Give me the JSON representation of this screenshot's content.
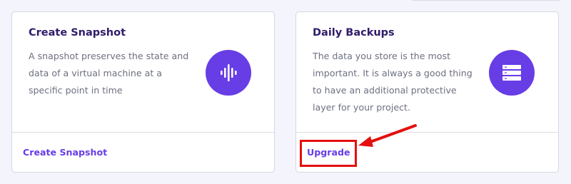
{
  "cards": [
    {
      "title": "Create Snapshot",
      "description": "A snapshot preserves the state and data of a virtual machine at a specific point in time",
      "icon": "soundwave-icon",
      "link_label": "Create Snapshot"
    },
    {
      "title": "Daily Backups",
      "description": "The data you store is the most important. It is always a good thing to have an additional protective layer for your project.",
      "icon": "server-stack-icon",
      "link_label": "Upgrade"
    }
  ],
  "annotation": {
    "color": "#e3100e",
    "target": "upgrade-link"
  },
  "colors": {
    "accent": "#673de6",
    "title": "#2f1c6a",
    "body_text": "#6d7081",
    "background": "#f4f5fc"
  }
}
